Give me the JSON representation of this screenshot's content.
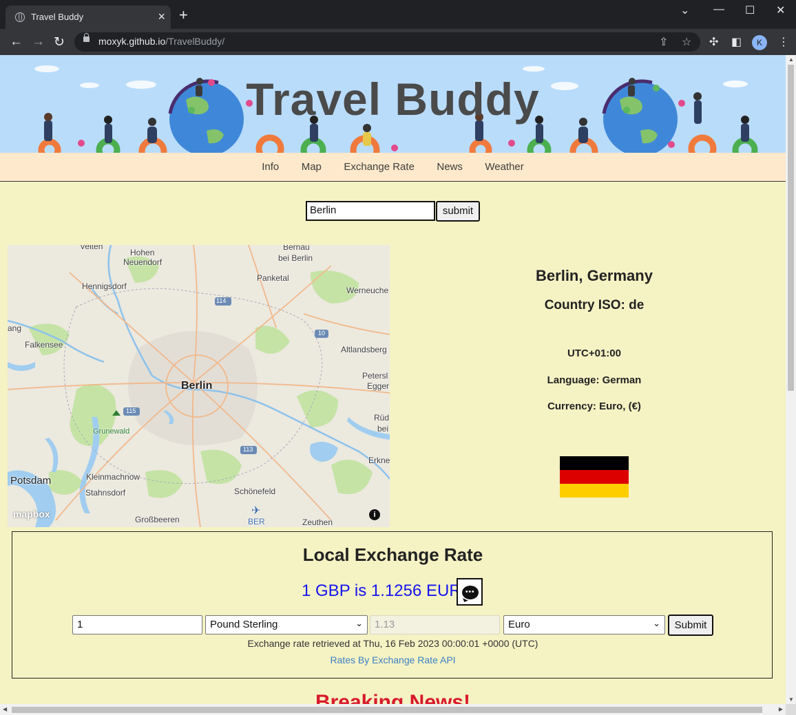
{
  "browser": {
    "tab_title": "Travel Buddy",
    "url_host": "moxyk.github.io",
    "url_path": "/TravelBuddy/",
    "profile_initial": "K"
  },
  "banner": {
    "title": "Travel Buddy"
  },
  "nav": {
    "items": [
      "Info",
      "Map",
      "Exchange Rate",
      "News",
      "Weather"
    ]
  },
  "search": {
    "value": "Berlin",
    "button": "submit"
  },
  "map": {
    "labels": {
      "velten": "Velten",
      "hohen": "Hohen",
      "neuendorf": "Neuendorf",
      "bernau": "Bernau",
      "beiberlin": "bei Berlin",
      "hennigsdorf": "Hennigsdorf",
      "panketal": "Panketal",
      "werneuchen": "Werneuche",
      "r114": "114",
      "r10": "10",
      "nauen": "ang",
      "falkensee": "Falkensee",
      "altlandsberg": "Altlandsberg",
      "berlin": "Berlin",
      "petersh": "Petersl",
      "eggers": "Egger",
      "r115": "115",
      "grunewald": "Grunewald",
      "rudersdorf": "Rüd",
      "bei": "bei",
      "r113": "113",
      "erkner": "Erkne",
      "potsdam": "Potsdam",
      "kleinmachnow": "Kleinmachnow",
      "stahnsdorf": "Stahnsdorf",
      "schonefeld": "Schönefeld",
      "grossbeeren": "Großbeeren",
      "ber": "BER",
      "zeuthen": "Zeuthen"
    },
    "attribution": "mapbox",
    "info_glyph": "i"
  },
  "info": {
    "city_title": "Berlin, Germany",
    "country_iso": "Country ISO: de",
    "utc": "UTC+01:00",
    "language": "Language: German",
    "currency": "Currency: Euro, (€)",
    "flag_colors": [
      "#000000",
      "#dd0000",
      "#ffce00"
    ]
  },
  "exchange": {
    "title": "Local Exchange Rate",
    "rate_text": "1 GBP is 1.1256 EUR",
    "amount": "1",
    "from_currency": "Pound Sterling",
    "converted": "1.13",
    "to_currency": "Euro",
    "submit": "Submit",
    "retrieved": "Exchange rate retrieved at Thu, 16 Feb 2023 00:00:01 +0000 (UTC)",
    "source_link": "Rates By Exchange Rate API"
  },
  "news": {
    "heading": "Breaking News!"
  }
}
